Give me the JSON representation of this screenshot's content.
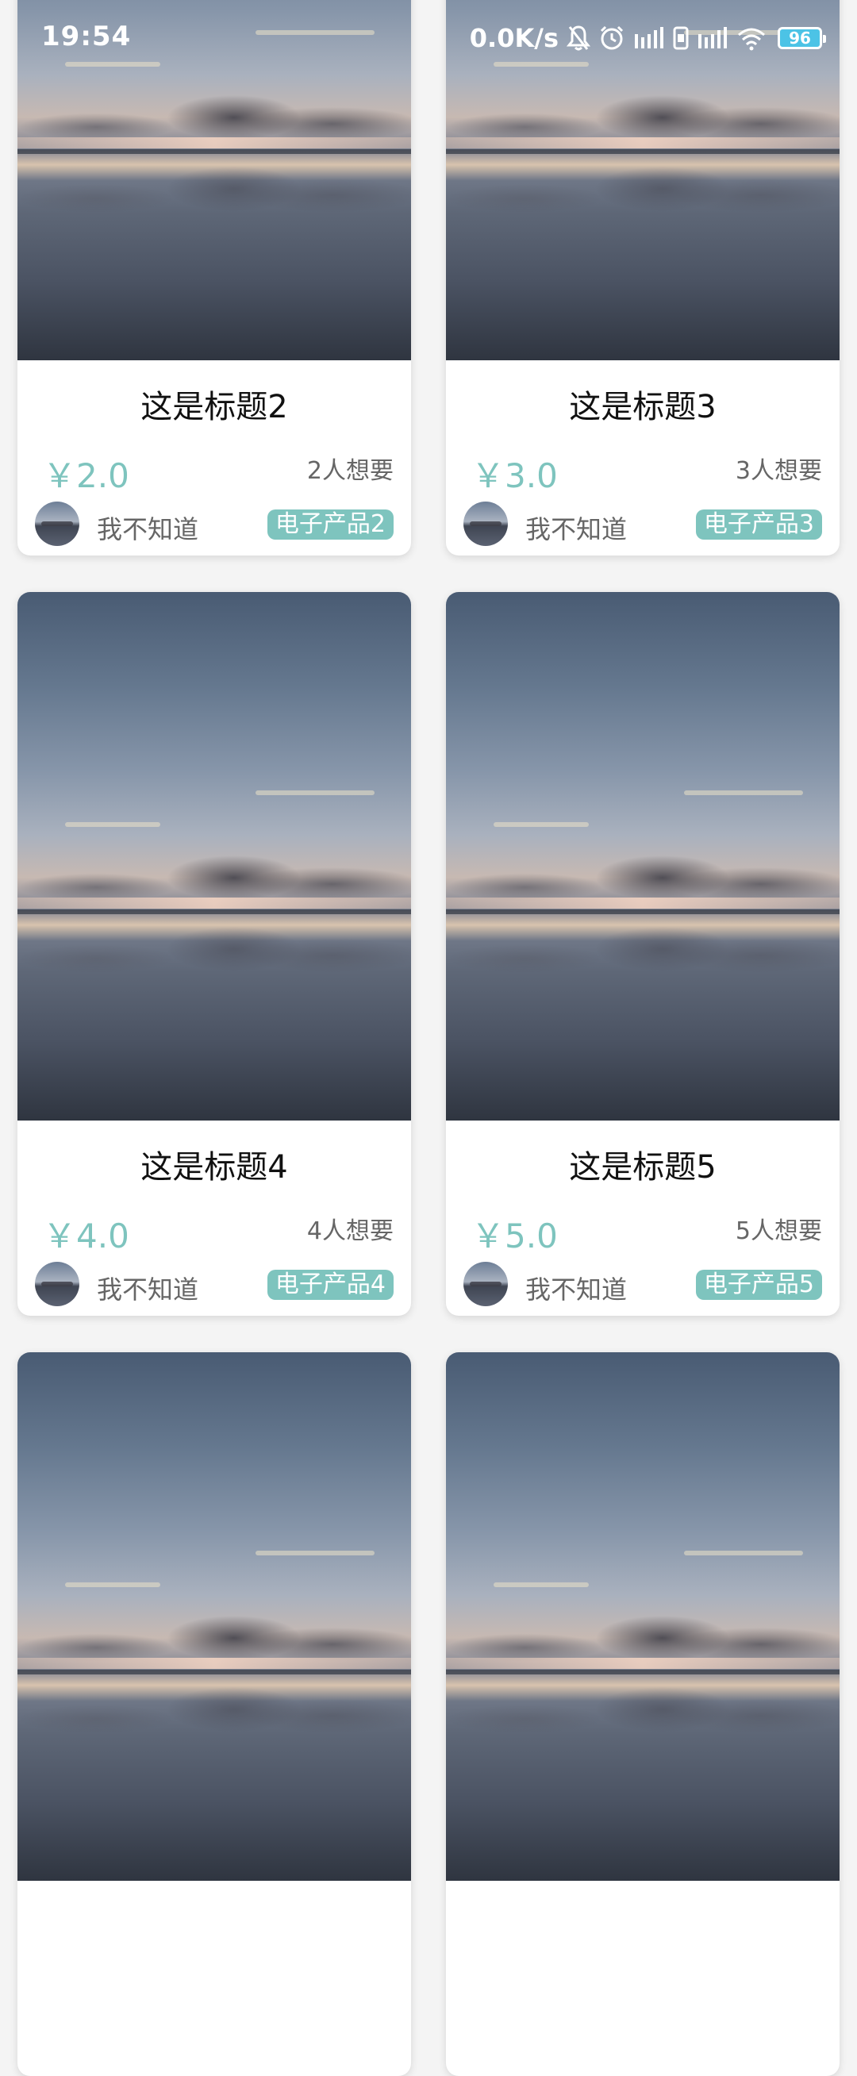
{
  "status_bar": {
    "time": "19:54",
    "net_speed": "0.0K/s",
    "battery_level": "96",
    "icons": [
      "mute-bell-icon",
      "alarm-icon",
      "signal-icon",
      "sim-icon",
      "signal-icon",
      "wifi-icon",
      "battery-icon"
    ]
  },
  "colors": {
    "accent": "#7ec4be",
    "battery": "#4cc3e6"
  },
  "cards": [
    {
      "title": "这是标题2",
      "price": "￥2.0",
      "wants": "2人想要",
      "user": "我不知道",
      "tag": "电子产品2"
    },
    {
      "title": "这是标题3",
      "price": "￥3.0",
      "wants": "3人想要",
      "user": "我不知道",
      "tag": "电子产品3"
    },
    {
      "title": "这是标题4",
      "price": "￥4.0",
      "wants": "4人想要",
      "user": "我不知道",
      "tag": "电子产品4"
    },
    {
      "title": "这是标题5",
      "price": "￥5.0",
      "wants": "5人想要",
      "user": "我不知道",
      "tag": "电子产品5"
    },
    {
      "title": "",
      "price": "",
      "wants": "",
      "user": "",
      "tag": ""
    },
    {
      "title": "",
      "price": "",
      "wants": "",
      "user": "",
      "tag": ""
    }
  ]
}
